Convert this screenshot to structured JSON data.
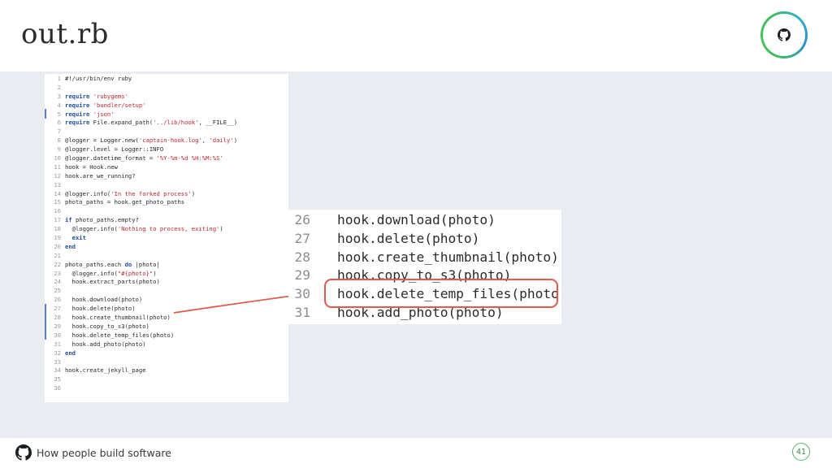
{
  "slide": {
    "title": "out.rb",
    "footer_text": "How people build software",
    "page_number": "41"
  },
  "colors": {
    "accent": "#e05a4e",
    "stage_background": "#e9edf1",
    "keyword": "#1f4fa8",
    "string": "#c0242f",
    "brand_green": "#3dbb63"
  },
  "icons": {
    "corner": "github-octocat-icon",
    "footer": "github-octocat-icon"
  },
  "editor": {
    "lines": [
      {
        "n": "1",
        "text": "#!/usr/bin/env ruby"
      },
      {
        "n": "2",
        "text": ""
      },
      {
        "n": "3",
        "text": "require 'rubygems'"
      },
      {
        "n": "4",
        "text": "require 'bundler/setup'"
      },
      {
        "n": "5",
        "text": "require 'json'"
      },
      {
        "n": "6",
        "text": "require File.expand_path('../lib/hook', __FILE__)"
      },
      {
        "n": "7",
        "text": ""
      },
      {
        "n": "8",
        "text": "@logger = Logger.new('captain-hook.log', 'daily')"
      },
      {
        "n": "9",
        "text": "@logger.level = Logger::INFO"
      },
      {
        "n": "10",
        "text": "@logger.datetime_format = '%Y-%m-%d %H:%M:%S'"
      },
      {
        "n": "11",
        "text": "hook = Hook.new"
      },
      {
        "n": "12",
        "text": "hook.are_we_running?"
      },
      {
        "n": "13",
        "text": ""
      },
      {
        "n": "14",
        "text": "@logger.info('In the forked process')"
      },
      {
        "n": "15",
        "text": "photo_paths = hook.get_photo_paths"
      },
      {
        "n": "16",
        "text": ""
      },
      {
        "n": "17",
        "text": "if photo_paths.empty?"
      },
      {
        "n": "18",
        "text": "  @logger.info('Nothing to process, exiting')"
      },
      {
        "n": "19",
        "text": "  exit"
      },
      {
        "n": "20",
        "text": "end"
      },
      {
        "n": "21",
        "text": ""
      },
      {
        "n": "22",
        "text": "photo_paths.each do |photo|"
      },
      {
        "n": "23",
        "text": "  @logger.info(\"#{photo}\")"
      },
      {
        "n": "24",
        "text": "  hook.extract_parts(photo)"
      },
      {
        "n": "25",
        "text": ""
      },
      {
        "n": "26",
        "text": "  hook.download(photo)"
      },
      {
        "n": "27",
        "text": "  hook.delete(photo)"
      },
      {
        "n": "28",
        "text": "  hook.create_thumbnail(photo)"
      },
      {
        "n": "29",
        "text": "  hook.copy_to_s3(photo)"
      },
      {
        "n": "30",
        "text": "  hook.delete_temp_files(photo)"
      },
      {
        "n": "31",
        "text": "  hook.add_photo(photo)"
      },
      {
        "n": "32",
        "text": "end"
      },
      {
        "n": "33",
        "text": ""
      },
      {
        "n": "34",
        "text": "hook.create_jekyll_page"
      },
      {
        "n": "35",
        "text": ""
      },
      {
        "n": "36",
        "text": ""
      }
    ]
  },
  "zoom": {
    "lines": [
      {
        "n": "26",
        "text": "hook.download(photo)"
      },
      {
        "n": "27",
        "text": "hook.delete(photo)"
      },
      {
        "n": "28",
        "text": "hook.create_thumbnail(photo)"
      },
      {
        "n": "29",
        "text": "hook.copy_to_s3(photo)"
      },
      {
        "n": "30",
        "text": "hook.delete_temp_files(photo)"
      },
      {
        "n": "31",
        "text": "hook.add_photo(photo)"
      }
    ]
  }
}
